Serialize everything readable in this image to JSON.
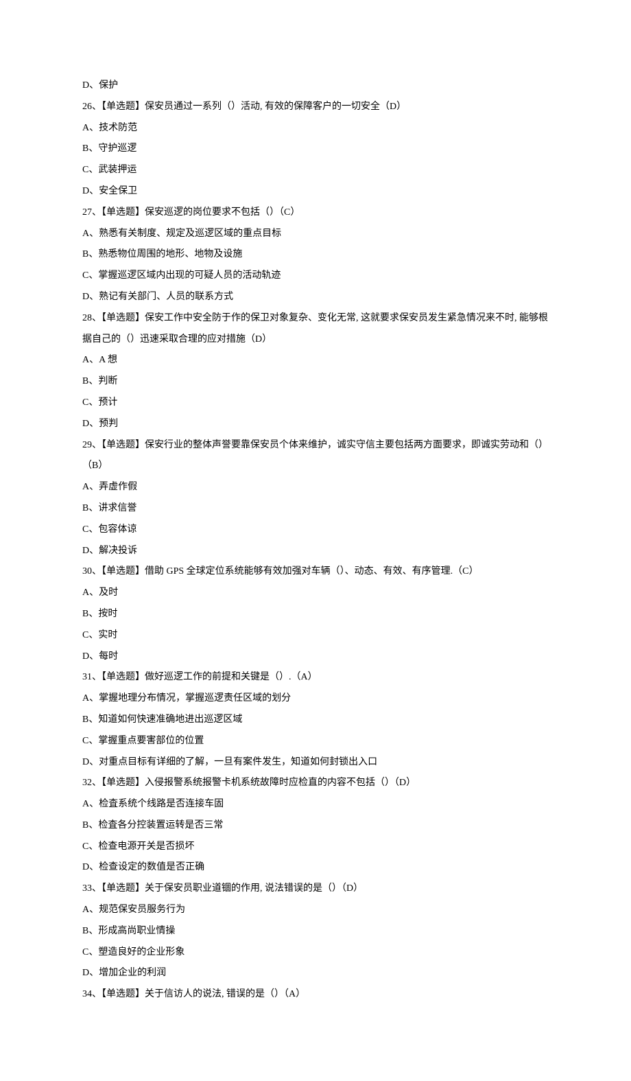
{
  "lines": [
    "D、保护",
    "26、【单选题】保安员通过一系列（）活动, 有效的保障客户的一切安全（D）",
    "A、技术防范",
    "B、守护巡逻",
    "C、武装押运",
    "D、安全保卫",
    "27、【单选题】保安巡逻的岗位要求不包括（）（C）",
    "A、熟悉有关制度、规定及巡逻区域的重点目标",
    "B、熟悉物位周围的地形、地物及设施",
    "C、掌握巡逻区域内出现的可疑人员的活动轨迹",
    "D、熟记有关部门、人员的联系方式",
    "28、【单选题】保安工作中安全防于作的保卫对象复杂、变化无常, 这就要求保安员发生紧急情况来不时, 能够根据自己的（）迅速采取合理的应对措施（D）",
    "A、A 想",
    "B、判断",
    "C、预计",
    "D、预判",
    "29、【单选题】保安行业的整体声誉要靠保安员个体来维护，诚实守信主要包括两方面要求，即诚实劳动和（）（B）",
    "A、弄虚作假",
    "B、讲求信誉",
    "C、包容体谅",
    "D、解决投诉",
    "30、【单选题】借助 GPS 全球定位系统能够有效加强对车辆（）、动态、有效、有序管理.（C）",
    "A、及时",
    "B、按时",
    "C、实时",
    "D、每时",
    "31、【单选题】做好巡逻工作的前提和关键是（）.（A）",
    "A、掌握地理分布情况，掌握巡逻责任区域的划分",
    "B、知道如何快速准确地进出巡逻区域",
    "C、掌握重点要害部位的位置",
    "D、对重点目标有详细的了解，一旦有案件发生，知道如何封锁出入口",
    "32、【单选题】入侵报警系统报警卡机系统故障时应检直的内容不包括（）（D）",
    "A、检査系统个线路是否连接车固",
    "B、检査各分控装置运转是否三常",
    "C、检查电源开关是否损坏",
    "D、检查设定的数值是否正确",
    "33、【单选题】关于保安员职业道锢的作用, 说法错误的是（）（D）",
    "A、规范保安员服务行为",
    "B、形成高尚职业情操",
    "C、塑造良好的企业形象",
    "D、增加企业的利润",
    "34、【单选题】关于信访人的说法, 错误的是（）（A）"
  ]
}
